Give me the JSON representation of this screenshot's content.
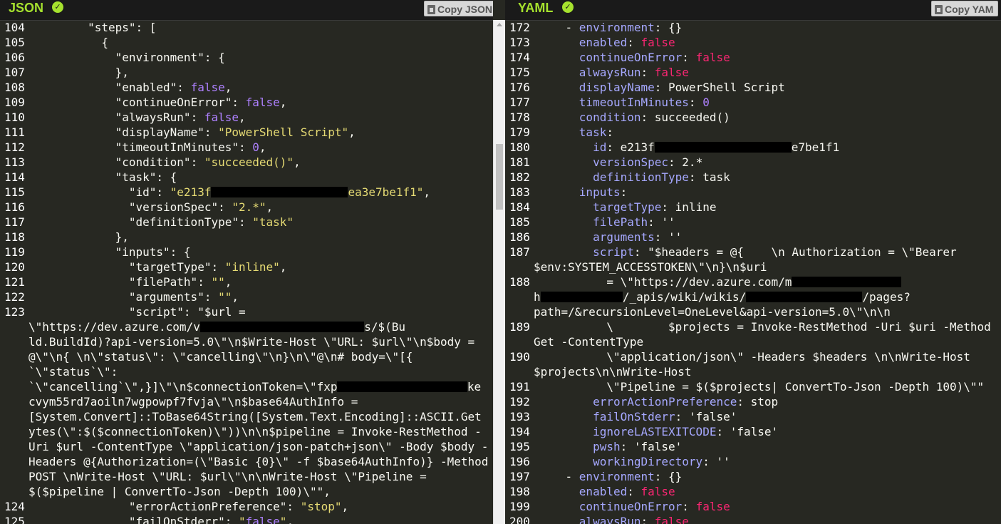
{
  "json_panel": {
    "title": "JSON",
    "copy_label": "Copy JSON",
    "lines": [
      {
        "num": "104",
        "text": "        \"steps\": ["
      },
      {
        "num": "105",
        "text": "          {"
      },
      {
        "num": "106",
        "text": "            \"environment\": {"
      },
      {
        "num": "107",
        "text": "            },"
      },
      {
        "num": "108",
        "text": "            \"enabled\": false,"
      },
      {
        "num": "109",
        "text": "            \"continueOnError\": false,"
      },
      {
        "num": "110",
        "text": "            \"alwaysRun\": false,"
      },
      {
        "num": "111",
        "text": "            \"displayName\": \"PowerShell Script\","
      },
      {
        "num": "112",
        "text": "            \"timeoutInMinutes\": 0,"
      },
      {
        "num": "113",
        "text": "            \"condition\": \"succeeded()\","
      },
      {
        "num": "114",
        "text": "            \"task\": {"
      },
      {
        "num": "115",
        "text": "              \"id\": \"e213f████████████████████ea3e7be1f1\","
      },
      {
        "num": "116",
        "text": "              \"versionSpec\": \"2.*\","
      },
      {
        "num": "117",
        "text": "              \"definitionType\": \"task\""
      },
      {
        "num": "118",
        "text": "            },"
      },
      {
        "num": "119",
        "text": "            \"inputs\": {"
      },
      {
        "num": "120",
        "text": "              \"targetType\": \"inline\","
      },
      {
        "num": "121",
        "text": "              \"filePath\": \"\","
      },
      {
        "num": "122",
        "text": "              \"arguments\": \"\","
      },
      {
        "num": "123",
        "text": "              \"script\": \"$url ="
      },
      {
        "num": "",
        "text": "\\\"https://dev.azure.com/v████████████████████████s/$(Bu"
      },
      {
        "num": "",
        "text": "ld.BuildId)?api-version=5.0\\\"\\n$Write-Host \\\"URL: $url\\\"\\n$body ="
      },
      {
        "num": "",
        "text": "@\\\"\\n{ \\n\\\"status\\\": \\\"cancelling\\\"\\n}\\n\\\"@\\n# body=\\\"[{"
      },
      {
        "num": "",
        "text": "`\\\"status`\\\":"
      },
      {
        "num": "",
        "text": "`\\\"cancelling`\\\",}]\\\"\\n$connectionToken=\\\"fxp███████████████████ke"
      },
      {
        "num": "",
        "text": "cvym55rd7aoiln7wgpowpf7fvja\\\"\\n$base64AuthInfo ="
      },
      {
        "num": "",
        "text": "[System.Convert]::ToBase64String([System.Text.Encoding]::ASCII.Get"
      },
      {
        "num": "",
        "text": "ytes(\\\":$($connectionToken)\\\"))\\n\\n$pipeline = Invoke-RestMethod -"
      },
      {
        "num": "",
        "text": "Uri $url -ContentType \\\"application/json-patch+json\\\" -Body $body -"
      },
      {
        "num": "",
        "text": "Headers @{Authorization=(\\\"Basic {0}\\\" -f $base64AuthInfo)} -Method"
      },
      {
        "num": "",
        "text": "POST \\nWrite-Host \\\"URL: $url\\\"\\n\\nWrite-Host \\\"Pipeline ="
      },
      {
        "num": "",
        "text": "$($pipeline | ConvertTo-Json -Depth 100)\\\"\","
      },
      {
        "num": "124",
        "text": "              \"errorActionPreference\": \"stop\","
      },
      {
        "num": "125",
        "text": "              \"failOnStderr\": \"false\","
      }
    ]
  },
  "yaml_panel": {
    "title": "YAML",
    "copy_label": "Copy YAM",
    "lines": [
      {
        "num": "172",
        "text": "    - environment: {}"
      },
      {
        "num": "173",
        "text": "      enabled: false"
      },
      {
        "num": "174",
        "text": "      continueOnError: false"
      },
      {
        "num": "175",
        "text": "      alwaysRun: false"
      },
      {
        "num": "176",
        "text": "      displayName: PowerShell Script"
      },
      {
        "num": "177",
        "text": "      timeoutInMinutes: 0"
      },
      {
        "num": "178",
        "text": "      condition: succeeded()"
      },
      {
        "num": "179",
        "text": "      task:"
      },
      {
        "num": "180",
        "text": "        id: e213f████████████████████e7be1f1"
      },
      {
        "num": "181",
        "text": "        versionSpec: 2.*"
      },
      {
        "num": "182",
        "text": "        definitionType: task"
      },
      {
        "num": "183",
        "text": "      inputs:"
      },
      {
        "num": "184",
        "text": "        targetType: inline"
      },
      {
        "num": "185",
        "text": "        filePath: ''"
      },
      {
        "num": "186",
        "text": "        arguments: ''"
      },
      {
        "num": "187",
        "text": "        script: \"$headers = @{    \\n Authorization = \\\"Bearer"
      },
      {
        "num": "",
        "text": "$env:SYSTEM_ACCESSTOKEN\\\"\\n}\\n$uri"
      },
      {
        "num": "188",
        "text": "          = \\\"https://dev.azure.com/m████████████████"
      },
      {
        "num": "",
        "text": "h████████████/_apis/wiki/wikis/█████████████████/pages?"
      },
      {
        "num": "",
        "text": "path=/&recursionLevel=OneLevel&api-version=5.0\\\"\\n\\n"
      },
      {
        "num": "189",
        "text": "          \\        $projects = Invoke-RestMethod -Uri $uri -Method"
      },
      {
        "num": "",
        "text": "Get -ContentType"
      },
      {
        "num": "190",
        "text": "          \\\"application/json\\\" -Headers $headers \\n\\nWrite-Host"
      },
      {
        "num": "",
        "text": "$projects\\n\\nWrite-Host"
      },
      {
        "num": "191",
        "text": "          \\\"Pipeline = $($projects| ConvertTo-Json -Depth 100)\\\"\""
      },
      {
        "num": "192",
        "text": "        errorActionPreference: stop"
      },
      {
        "num": "193",
        "text": "        failOnStderr: 'false'"
      },
      {
        "num": "194",
        "text": "        ignoreLASTEXITCODE: 'false'"
      },
      {
        "num": "195",
        "text": "        pwsh: 'false'"
      },
      {
        "num": "196",
        "text": "        workingDirectory: ''"
      },
      {
        "num": "197",
        "text": "    - environment: {}"
      },
      {
        "num": "198",
        "text": "      enabled: false"
      },
      {
        "num": "199",
        "text": "      continueOnError: false"
      },
      {
        "num": "200",
        "text": "      alwaysRun: false"
      }
    ]
  }
}
